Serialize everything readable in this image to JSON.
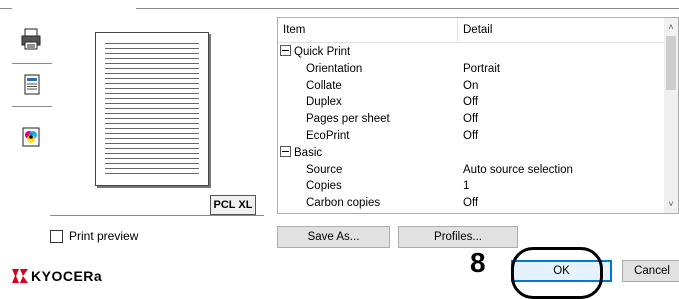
{
  "list": {
    "header_item": "Item",
    "header_detail": "Detail",
    "rows": [
      {
        "type": "group",
        "item": "Quick Print",
        "detail": ""
      },
      {
        "type": "child",
        "item": "Orientation",
        "detail": "Portrait"
      },
      {
        "type": "child",
        "item": "Collate",
        "detail": "On"
      },
      {
        "type": "child",
        "item": "Duplex",
        "detail": "Off"
      },
      {
        "type": "child",
        "item": "Pages per sheet",
        "detail": "Off"
      },
      {
        "type": "child",
        "item": "EcoPrint",
        "detail": "Off"
      },
      {
        "type": "group",
        "item": "Basic",
        "detail": ""
      },
      {
        "type": "child",
        "item": "Source",
        "detail": "Auto source selection"
      },
      {
        "type": "child",
        "item": "Copies",
        "detail": "1"
      },
      {
        "type": "child",
        "item": "Carbon copies",
        "detail": "Off"
      }
    ]
  },
  "preview": {
    "pdl_badge": "PCL XL"
  },
  "controls": {
    "print_preview_label": "Print preview",
    "save_as_label": "Save As...",
    "profiles_label": "Profiles...",
    "ok_label": "OK",
    "cancel_label": "Cancel"
  },
  "logo": {
    "text": "KYOCERa"
  },
  "annotation": {
    "step_number": "8"
  },
  "colors": {
    "accent": "#0078d7",
    "logo_red": "#d6001c"
  },
  "icons": {
    "tabs": [
      "printer-icon",
      "document-icon",
      "color-icon"
    ],
    "scroll": [
      "scroll-up-icon",
      "scroll-down-icon"
    ]
  }
}
